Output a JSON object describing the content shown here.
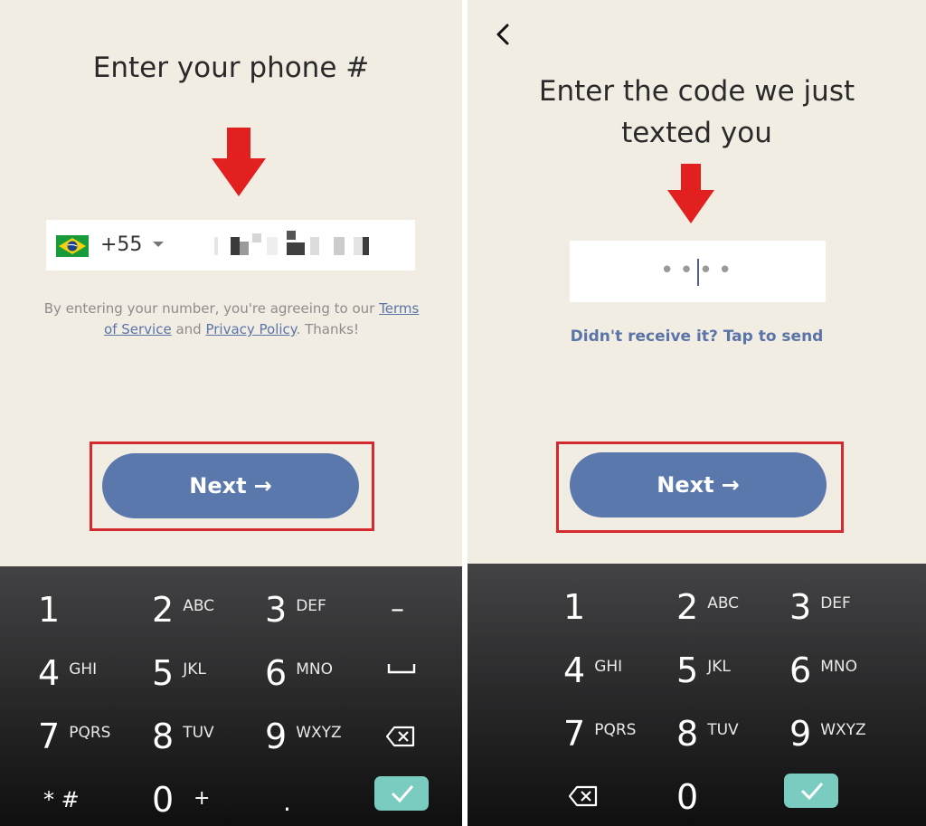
{
  "left": {
    "title": "Enter your phone #",
    "country_code": "+55",
    "country_flag": "brazil-flag-icon",
    "phone_value": "",
    "terms": {
      "prefix": "By entering your number, you're agreeing to our ",
      "terms_link": "Terms of Service",
      "middle": " and ",
      "privacy_link": "Privacy Policy",
      "suffix": ". Thanks!"
    },
    "next_label": "Next"
  },
  "right": {
    "title_line1": "Enter the code we just",
    "title_line2": "texted you",
    "code_dots": [
      "•",
      "•",
      "•",
      "•"
    ],
    "resend": "Didn't receive it? Tap to send",
    "next_label": "Next"
  },
  "keypad_left": {
    "k1": "1",
    "k2": "2",
    "k2l": "ABC",
    "k3": "3",
    "k3l": "DEF",
    "dash": "–",
    "k4": "4",
    "k4l": "GHI",
    "k5": "5",
    "k5l": "JKL",
    "k6": "6",
    "k6l": "MNO",
    "k7": "7",
    "k7l": "PQRS",
    "k8": "8",
    "k8l": "TUV",
    "k9": "9",
    "k9l": "WXYZ",
    "star": "* #",
    "k0": "0",
    "plus": "+",
    "dot": "."
  },
  "keypad_right": {
    "k1": "1",
    "k2": "2",
    "k2l": "ABC",
    "k3": "3",
    "k3l": "DEF",
    "k4": "4",
    "k4l": "GHI",
    "k5": "5",
    "k5l": "JKL",
    "k6": "6",
    "k6l": "MNO",
    "k7": "7",
    "k7l": "PQRS",
    "k8": "8",
    "k8l": "TUV",
    "k9": "9",
    "k9l": "WXYZ",
    "k0": "0"
  },
  "colors": {
    "accent": "#5b78ad",
    "highlight": "#d42a2f",
    "arrow": "#e2201f",
    "confirm": "#79ccbf"
  }
}
